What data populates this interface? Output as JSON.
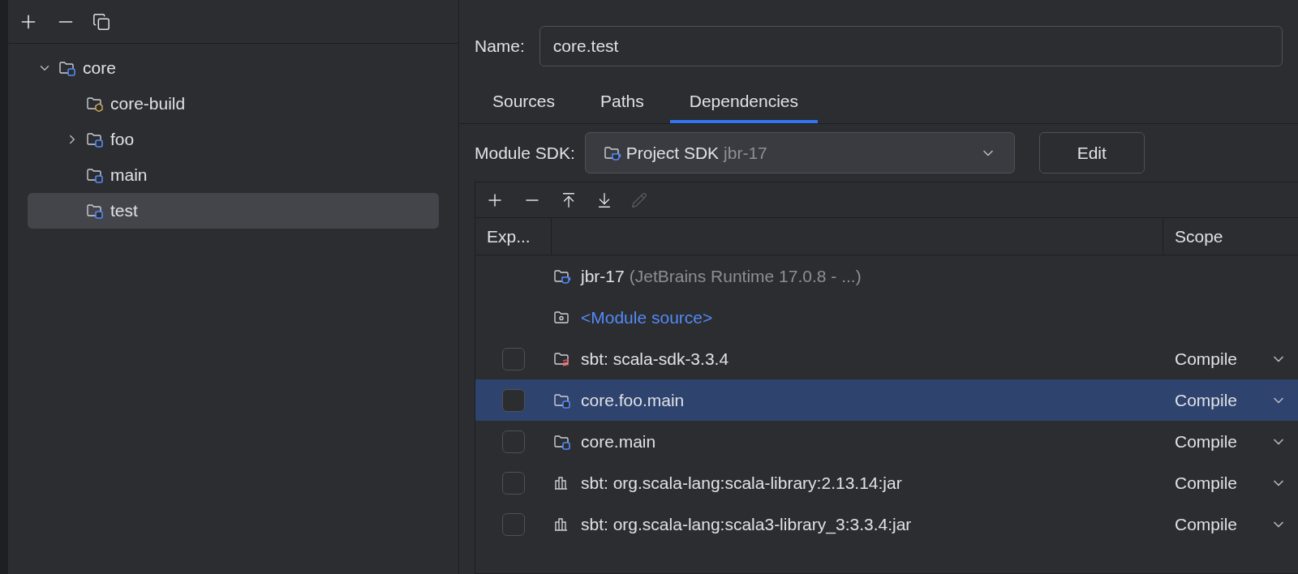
{
  "tree": [
    {
      "label": "core",
      "kind": "module",
      "expanded": true,
      "selected": false,
      "children": [
        {
          "label": "core-build",
          "kind": "build",
          "selected": false
        },
        {
          "label": "foo",
          "kind": "module",
          "expanded": false,
          "selected": false
        },
        {
          "label": "main",
          "kind": "module",
          "selected": false
        },
        {
          "label": "test",
          "kind": "module",
          "selected": true
        }
      ]
    }
  ],
  "name_field": {
    "label": "Name:",
    "value": "core.test"
  },
  "tabs": [
    {
      "label": "Sources",
      "selected": false
    },
    {
      "label": "Paths",
      "selected": false
    },
    {
      "label": "Dependencies",
      "selected": true
    }
  ],
  "module_sdk": {
    "label": "Module SDK:",
    "value": "Project SDK",
    "hint": "jbr-17",
    "button": "Edit"
  },
  "table": {
    "columns": [
      "Exp...",
      "Scope"
    ],
    "rows": [
      {
        "kind": "sdk",
        "name": "jbr-17",
        "detail": "(JetBrains Runtime 17.0.8 - ...)",
        "selected": false
      },
      {
        "kind": "source",
        "name": "<Module source>",
        "selected": false
      },
      {
        "kind": "scala",
        "name": "sbt: scala-sdk-3.3.4",
        "checked": false,
        "scope": "Compile",
        "selected": false
      },
      {
        "kind": "module",
        "name": "core.foo.main",
        "checked": false,
        "scope": "Compile",
        "selected": true
      },
      {
        "kind": "module",
        "name": "core.main",
        "checked": false,
        "scope": "Compile",
        "selected": false
      },
      {
        "kind": "library",
        "name": "sbt: org.scala-lang:scala-library:2.13.14:jar",
        "checked": false,
        "scope": "Compile",
        "selected": false
      },
      {
        "kind": "library",
        "name": "sbt: org.scala-lang:scala3-library_3:3.3.4:jar",
        "checked": false,
        "scope": "Compile",
        "selected": false
      }
    ]
  }
}
